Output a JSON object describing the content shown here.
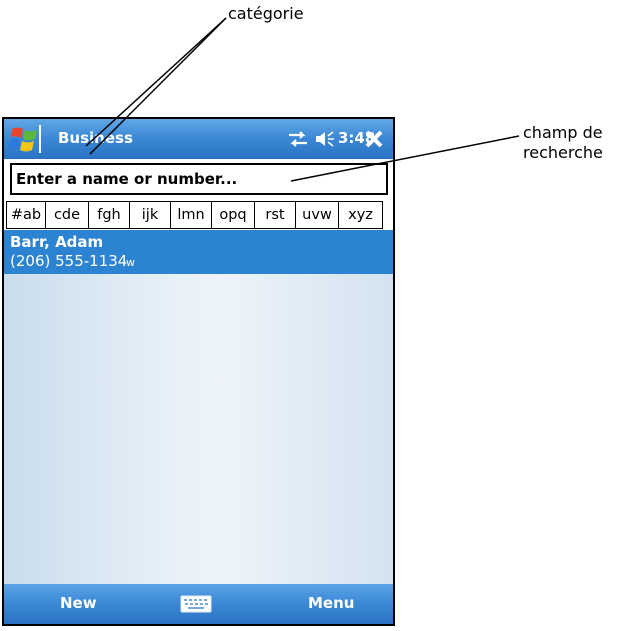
{
  "annotations": {
    "category": "catégorie",
    "search_line1": "champ de",
    "search_line2": "recherche"
  },
  "titlebar": {
    "category": "Business",
    "time": "3:48",
    "icons": [
      "windows-start-icon",
      "sync-icon",
      "volume-icon",
      "close-icon"
    ]
  },
  "search": {
    "placeholder": "Enter a name or number..."
  },
  "alpha_tabs": [
    "#ab",
    "cde",
    "fgh",
    "ijk",
    "lmn",
    "opq",
    "rst",
    "uvw",
    "xyz"
  ],
  "contacts": [
    {
      "name": "Barr, Adam",
      "phone": "(206) 555-1134",
      "type": "w"
    }
  ],
  "menubar": {
    "left": "New",
    "right": "Menu",
    "center_icon": "keyboard-icon"
  },
  "colors": {
    "titlebar": "#3d8ad6",
    "selection": "#2c83d2",
    "list_bg": "#e2edf6"
  }
}
